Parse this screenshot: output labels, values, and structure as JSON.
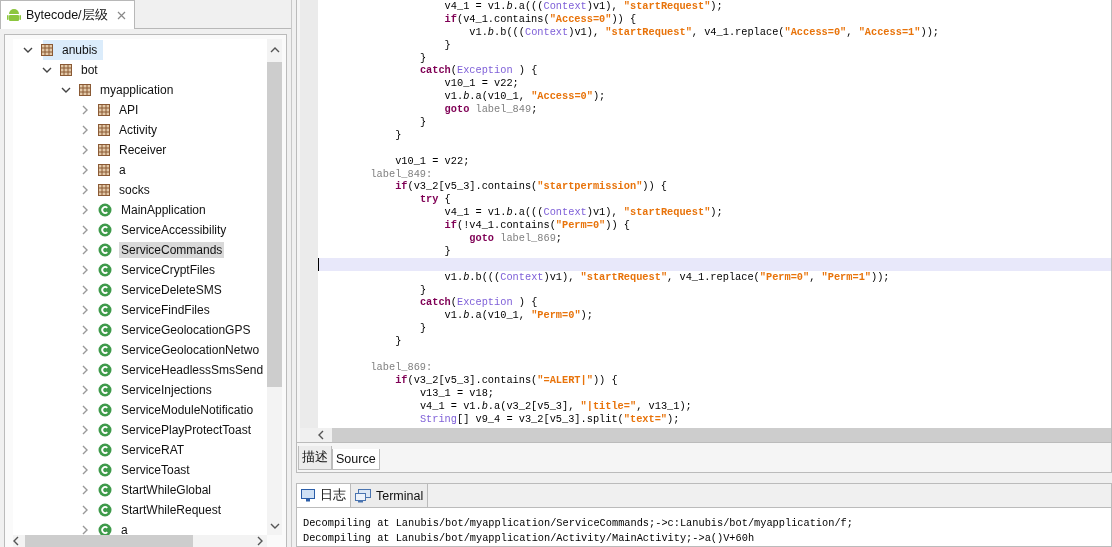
{
  "left_panel": {
    "tab": {
      "label": "Bytecode/层级",
      "selected": true
    },
    "tree": [
      {
        "label": "anubis",
        "kind": "package",
        "expanded": true,
        "selected": true,
        "highlighted": false,
        "children": [
          {
            "label": "bot",
            "kind": "package",
            "expanded": true,
            "selected": false,
            "highlighted": false,
            "children": [
              {
                "label": "myapplication",
                "kind": "package",
                "expanded": true,
                "selected": false,
                "highlighted": false,
                "children": [
                  {
                    "label": "API",
                    "kind": "package",
                    "expanded": false,
                    "selected": false,
                    "highlighted": false
                  },
                  {
                    "label": "Activity",
                    "kind": "package",
                    "expanded": false,
                    "selected": false,
                    "highlighted": false
                  },
                  {
                    "label": "Receiver",
                    "kind": "package",
                    "expanded": false,
                    "selected": false,
                    "highlighted": false
                  },
                  {
                    "label": "a",
                    "kind": "package",
                    "expanded": false,
                    "selected": false,
                    "highlighted": false
                  },
                  {
                    "label": "socks",
                    "kind": "package",
                    "expanded": false,
                    "selected": false,
                    "highlighted": false
                  },
                  {
                    "label": "MainApplication",
                    "kind": "class",
                    "expanded": false,
                    "selected": false,
                    "highlighted": false
                  },
                  {
                    "label": "ServiceAccessibility",
                    "kind": "class",
                    "expanded": false,
                    "selected": false,
                    "highlighted": false
                  },
                  {
                    "label": "ServiceCommands",
                    "kind": "class",
                    "expanded": false,
                    "selected": false,
                    "highlighted": true
                  },
                  {
                    "label": "ServiceCryptFiles",
                    "kind": "class",
                    "expanded": false,
                    "selected": false,
                    "highlighted": false
                  },
                  {
                    "label": "ServiceDeleteSMS",
                    "kind": "class",
                    "expanded": false,
                    "selected": false,
                    "highlighted": false
                  },
                  {
                    "label": "ServiceFindFiles",
                    "kind": "class",
                    "expanded": false,
                    "selected": false,
                    "highlighted": false
                  },
                  {
                    "label": "ServiceGeolocationGPS",
                    "kind": "class",
                    "expanded": false,
                    "selected": false,
                    "highlighted": false
                  },
                  {
                    "label": "ServiceGeolocationNetwo",
                    "kind": "class",
                    "expanded": false,
                    "selected": false,
                    "highlighted": false
                  },
                  {
                    "label": "ServiceHeadlessSmsSend",
                    "kind": "class",
                    "expanded": false,
                    "selected": false,
                    "highlighted": false
                  },
                  {
                    "label": "ServiceInjections",
                    "kind": "class",
                    "expanded": false,
                    "selected": false,
                    "highlighted": false
                  },
                  {
                    "label": "ServiceModuleNotificatio",
                    "kind": "class",
                    "expanded": false,
                    "selected": false,
                    "highlighted": false
                  },
                  {
                    "label": "ServicePlayProtectToast",
                    "kind": "class",
                    "expanded": false,
                    "selected": false,
                    "highlighted": false
                  },
                  {
                    "label": "ServiceRAT",
                    "kind": "class",
                    "expanded": false,
                    "selected": false,
                    "highlighted": false
                  },
                  {
                    "label": "ServiceToast",
                    "kind": "class",
                    "expanded": false,
                    "selected": false,
                    "highlighted": false
                  },
                  {
                    "label": "StartWhileGlobal",
                    "kind": "class",
                    "expanded": false,
                    "selected": false,
                    "highlighted": false
                  },
                  {
                    "label": "StartWhileRequest",
                    "kind": "class",
                    "expanded": false,
                    "selected": false,
                    "highlighted": false
                  },
                  {
                    "label": "a",
                    "kind": "class",
                    "expanded": false,
                    "selected": false,
                    "highlighted": false
                  }
                ]
              }
            ]
          }
        ]
      }
    ]
  },
  "editor": {
    "lines": [
      {
        "kind": "indent5",
        "current": false,
        "tokens": [
          {
            "kind": "plain",
            "t": "v4_1 = v1."
          },
          {
            "kind": "field",
            "t": "b"
          },
          {
            "kind": "plain",
            "t": ".a((("
          },
          {
            "kind": "type",
            "t": "Context"
          },
          {
            "kind": "plain",
            "t": ")v1), "
          },
          {
            "kind": "string",
            "t": "\"startRequest\""
          },
          {
            "kind": "plain",
            "t": ");"
          }
        ]
      },
      {
        "kind": "indent5",
        "current": false,
        "tokens": [
          {
            "kind": "keyword",
            "t": "if"
          },
          {
            "kind": "plain",
            "t": "(v4_1.contains("
          },
          {
            "kind": "string",
            "t": "\"Access=0\""
          },
          {
            "kind": "plain",
            "t": ")) {"
          }
        ]
      },
      {
        "kind": "indent6",
        "current": false,
        "tokens": [
          {
            "kind": "plain",
            "t": "v1."
          },
          {
            "kind": "field",
            "t": "b"
          },
          {
            "kind": "plain",
            "t": ".b((("
          },
          {
            "kind": "type",
            "t": "Context"
          },
          {
            "kind": "plain",
            "t": ")v1), "
          },
          {
            "kind": "string",
            "t": "\"startRequest\""
          },
          {
            "kind": "plain",
            "t": ", v4_1.replace("
          },
          {
            "kind": "string",
            "t": "\"Access=0\""
          },
          {
            "kind": "plain",
            "t": ", "
          },
          {
            "kind": "string",
            "t": "\"Access=1\""
          },
          {
            "kind": "plain",
            "t": "));"
          }
        ]
      },
      {
        "kind": "indent5",
        "current": false,
        "tokens": [
          {
            "kind": "plain",
            "t": "}"
          }
        ]
      },
      {
        "kind": "indent4",
        "current": false,
        "tokens": [
          {
            "kind": "plain",
            "t": "}"
          }
        ]
      },
      {
        "kind": "indent4",
        "current": false,
        "tokens": [
          {
            "kind": "keyword",
            "t": "catch"
          },
          {
            "kind": "plain",
            "t": "("
          },
          {
            "kind": "type",
            "t": "Exception"
          },
          {
            "kind": "plain",
            "t": " ) {"
          }
        ]
      },
      {
        "kind": "indent5",
        "current": false,
        "tokens": [
          {
            "kind": "plain",
            "t": "v10_1 = v22;"
          }
        ]
      },
      {
        "kind": "indent5",
        "current": false,
        "tokens": [
          {
            "kind": "plain",
            "t": "v1."
          },
          {
            "kind": "field",
            "t": "b"
          },
          {
            "kind": "plain",
            "t": ".a(v10_1, "
          },
          {
            "kind": "string",
            "t": "\"Access=0\""
          },
          {
            "kind": "plain",
            "t": ");"
          }
        ]
      },
      {
        "kind": "indent5",
        "current": false,
        "tokens": [
          {
            "kind": "keyword",
            "t": "goto "
          },
          {
            "kind": "label",
            "t": "label_849"
          },
          {
            "kind": "plain",
            "t": ";"
          }
        ]
      },
      {
        "kind": "indent4",
        "current": false,
        "tokens": [
          {
            "kind": "plain",
            "t": "}"
          }
        ]
      },
      {
        "kind": "indent3",
        "current": false,
        "tokens": [
          {
            "kind": "plain",
            "t": "}"
          }
        ]
      },
      {
        "kind": "blank",
        "current": false
      },
      {
        "kind": "indent3",
        "current": false,
        "tokens": [
          {
            "kind": "plain",
            "t": "v10_1 = v22;"
          }
        ]
      },
      {
        "kind": "indent2",
        "current": false,
        "tokens": [
          {
            "kind": "label",
            "t": "label_849:"
          }
        ]
      },
      {
        "kind": "indent3",
        "current": false,
        "tokens": [
          {
            "kind": "keyword",
            "t": "if"
          },
          {
            "kind": "plain",
            "t": "(v3_2[v5_3].contains("
          },
          {
            "kind": "string",
            "t": "\"startpermission\""
          },
          {
            "kind": "plain",
            "t": ")) {"
          }
        ]
      },
      {
        "kind": "indent4",
        "current": false,
        "tokens": [
          {
            "kind": "keyword",
            "t": "try"
          },
          {
            "kind": "plain",
            "t": " {"
          }
        ]
      },
      {
        "kind": "indent5",
        "current": false,
        "tokens": [
          {
            "kind": "plain",
            "t": "v4_1 = v1."
          },
          {
            "kind": "field",
            "t": "b"
          },
          {
            "kind": "plain",
            "t": ".a((("
          },
          {
            "kind": "type",
            "t": "Context"
          },
          {
            "kind": "plain",
            "t": ")v1), "
          },
          {
            "kind": "string",
            "t": "\"startRequest\""
          },
          {
            "kind": "plain",
            "t": ");"
          }
        ]
      },
      {
        "kind": "indent5",
        "current": false,
        "tokens": [
          {
            "kind": "keyword",
            "t": "if"
          },
          {
            "kind": "plain",
            "t": "(!v4_1.contains("
          },
          {
            "kind": "string",
            "t": "\"Perm=0\""
          },
          {
            "kind": "plain",
            "t": ")) {"
          }
        ]
      },
      {
        "kind": "indent6",
        "current": false,
        "tokens": [
          {
            "kind": "keyword",
            "t": "goto "
          },
          {
            "kind": "label",
            "t": "label_869"
          },
          {
            "kind": "plain",
            "t": ";"
          }
        ]
      },
      {
        "kind": "indent5",
        "current": false,
        "tokens": [
          {
            "kind": "plain",
            "t": "}"
          }
        ]
      },
      {
        "kind": "blank",
        "current": true
      },
      {
        "kind": "indent5",
        "current": false,
        "tokens": [
          {
            "kind": "plain",
            "t": "v1."
          },
          {
            "kind": "field",
            "t": "b"
          },
          {
            "kind": "plain",
            "t": ".b((("
          },
          {
            "kind": "type",
            "t": "Context"
          },
          {
            "kind": "plain",
            "t": ")v1), "
          },
          {
            "kind": "string",
            "t": "\"startRequest\""
          },
          {
            "kind": "plain",
            "t": ", v4_1.replace("
          },
          {
            "kind": "string",
            "t": "\"Perm=0\""
          },
          {
            "kind": "plain",
            "t": ", "
          },
          {
            "kind": "string",
            "t": "\"Perm=1\""
          },
          {
            "kind": "plain",
            "t": "));"
          }
        ]
      },
      {
        "kind": "indent4",
        "current": false,
        "tokens": [
          {
            "kind": "plain",
            "t": "}"
          }
        ]
      },
      {
        "kind": "indent4",
        "current": false,
        "tokens": [
          {
            "kind": "keyword",
            "t": "catch"
          },
          {
            "kind": "plain",
            "t": "("
          },
          {
            "kind": "type",
            "t": "Exception"
          },
          {
            "kind": "plain",
            "t": " ) {"
          }
        ]
      },
      {
        "kind": "indent5",
        "current": false,
        "tokens": [
          {
            "kind": "plain",
            "t": "v1."
          },
          {
            "kind": "field",
            "t": "b"
          },
          {
            "kind": "plain",
            "t": ".a(v10_1, "
          },
          {
            "kind": "string",
            "t": "\"Perm=0\""
          },
          {
            "kind": "plain",
            "t": ");"
          }
        ]
      },
      {
        "kind": "indent4",
        "current": false,
        "tokens": [
          {
            "kind": "plain",
            "t": "}"
          }
        ]
      },
      {
        "kind": "indent3",
        "current": false,
        "tokens": [
          {
            "kind": "plain",
            "t": "}"
          }
        ]
      },
      {
        "kind": "blank",
        "current": false
      },
      {
        "kind": "indent2",
        "current": false,
        "tokens": [
          {
            "kind": "label",
            "t": "label_869:"
          }
        ]
      },
      {
        "kind": "indent3",
        "current": false,
        "tokens": [
          {
            "kind": "keyword",
            "t": "if"
          },
          {
            "kind": "plain",
            "t": "(v3_2[v5_3].contains("
          },
          {
            "kind": "string",
            "t": "\"=ALERT|\""
          },
          {
            "kind": "plain",
            "t": ")) {"
          }
        ]
      },
      {
        "kind": "indent4",
        "current": false,
        "tokens": [
          {
            "kind": "plain",
            "t": "v13_1 = v18;"
          }
        ]
      },
      {
        "kind": "indent4",
        "current": false,
        "tokens": [
          {
            "kind": "plain",
            "t": "v4_1 = v1."
          },
          {
            "kind": "field",
            "t": "b"
          },
          {
            "kind": "plain",
            "t": ".a(v3_2[v5_3], "
          },
          {
            "kind": "string",
            "t": "\"|title=\""
          },
          {
            "kind": "plain",
            "t": ", v13_1);"
          }
        ]
      },
      {
        "kind": "indent4",
        "current": false,
        "tokens": [
          {
            "kind": "type",
            "t": "String"
          },
          {
            "kind": "plain",
            "t": "[] v9_4 = v3_2[v5_3].split("
          },
          {
            "kind": "string",
            "t": "\"text=\""
          },
          {
            "kind": "plain",
            "t": ");"
          }
        ]
      }
    ]
  },
  "editor_tabs": [
    {
      "label": "描述",
      "selected": false
    },
    {
      "label": "Source",
      "selected": true
    }
  ],
  "log_panel": {
    "tabs": [
      {
        "label": "日志",
        "selected": true
      },
      {
        "label": "Terminal",
        "selected": false
      }
    ],
    "lines": [
      "Decompiling at Lanubis/bot/myapplication/ServiceCommands;->c:Lanubis/bot/myapplication/f;",
      "Decompiling at Lanubis/bot/myapplication/Activity/MainActivity;->a()V+60h"
    ]
  }
}
